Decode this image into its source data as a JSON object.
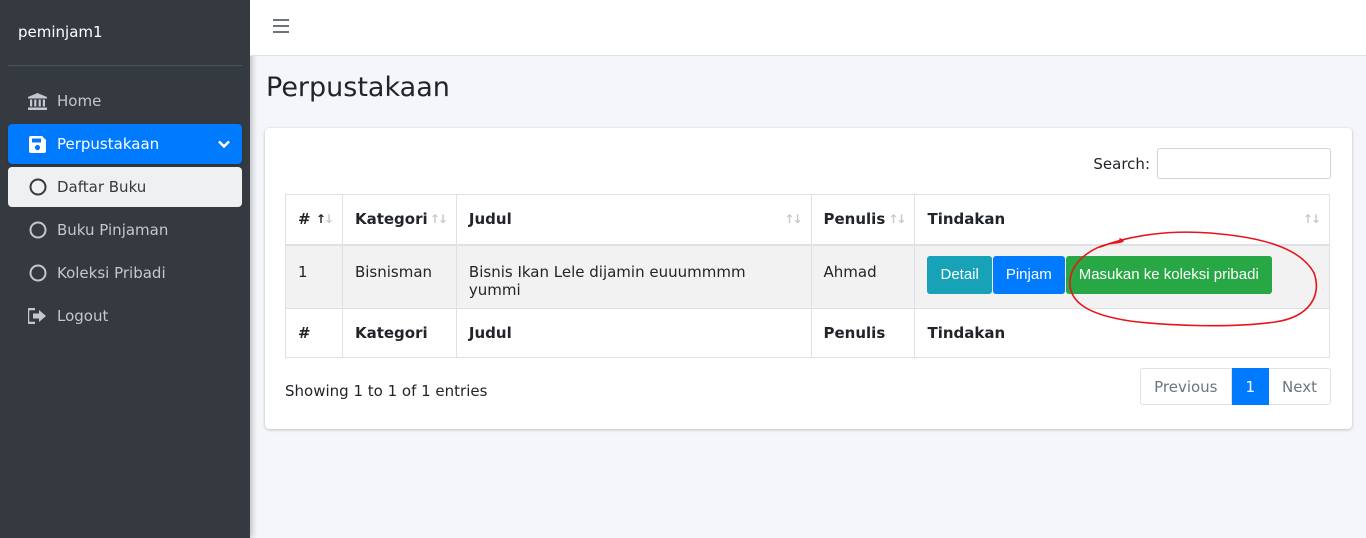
{
  "sidebar": {
    "brand": "peminjam1",
    "items": [
      {
        "label": "Home",
        "icon": "bank-icon"
      },
      {
        "label": "Perpustakaan",
        "icon": "save-icon"
      },
      {
        "label": "Daftar Buku",
        "icon": "circle-icon"
      },
      {
        "label": "Buku Pinjaman",
        "icon": "circle-icon"
      },
      {
        "label": "Koleksi Pribadi",
        "icon": "circle-icon"
      },
      {
        "label": "Logout",
        "icon": "sign-out-icon"
      }
    ]
  },
  "page": {
    "title": "Perpustakaan"
  },
  "search": {
    "label": "Search:",
    "value": ""
  },
  "table": {
    "headers": [
      "#",
      "Kategori",
      "Judul",
      "Penulis",
      "Tindakan"
    ],
    "rows": [
      {
        "no": "1",
        "kategori": "Bisnisman",
        "judul": "Bisnis Ikan Lele dijamin euuummmm yummi",
        "penulis": "Ahmad"
      }
    ],
    "actions": {
      "detail": "Detail",
      "pinjam": "Pinjam",
      "koleksi": "Masukan ke koleksi pribadi"
    }
  },
  "footer": {
    "info": "Showing 1 to 1 of 1 entries",
    "pagination": {
      "previous": "Previous",
      "current": "1",
      "next": "Next"
    }
  },
  "colors": {
    "primary": "#007bff",
    "info": "#17a2b8",
    "success": "#28a745",
    "sidebar": "#343a40",
    "annotation": "#e8141a"
  }
}
